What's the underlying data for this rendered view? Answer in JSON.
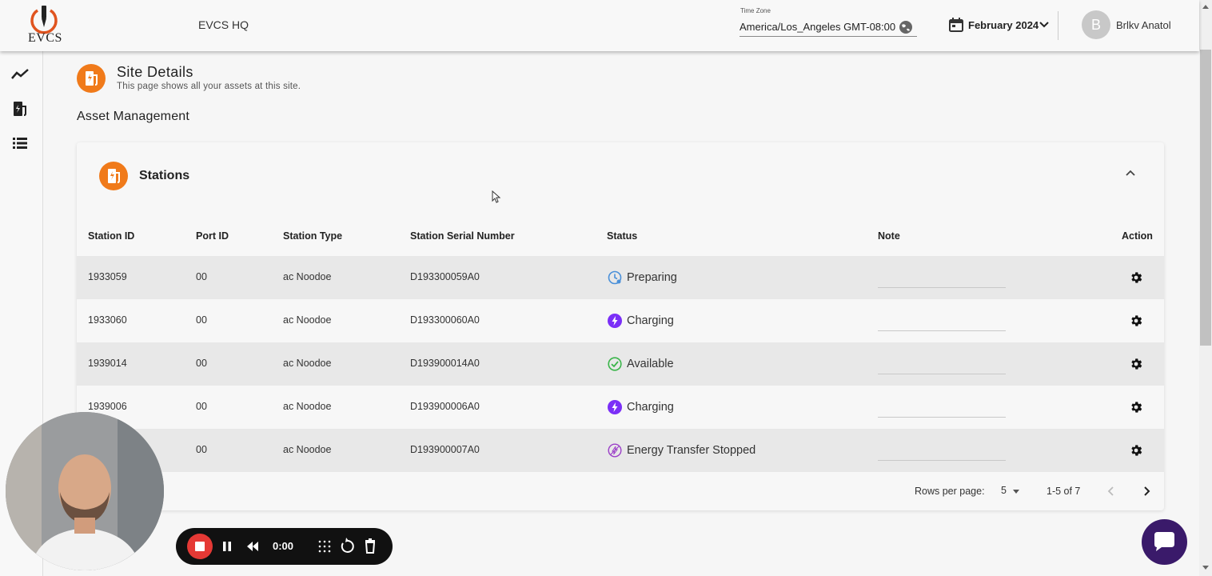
{
  "header": {
    "logo_text": "EVCS",
    "site_name": "EVCS HQ",
    "timezone_label": "Time Zone",
    "timezone_value": "America/Los_Angeles GMT-08:00",
    "month": "February 2024",
    "user_initial": "B",
    "user_name": "Brlkv Anatol"
  },
  "sidebar": {
    "items": [
      {
        "icon": "trend-chart-icon"
      },
      {
        "icon": "ev-station-icon"
      },
      {
        "icon": "list-icon"
      }
    ]
  },
  "page": {
    "title": "Site Details",
    "subtitle": "This page shows all your assets at this site.",
    "section_title": "Asset Management"
  },
  "stations": {
    "title": "Stations",
    "columns": [
      "Station ID",
      "Port ID",
      "Station Type",
      "Station Serial Number",
      "Status",
      "Note",
      "Action"
    ],
    "rows": [
      {
        "station_id": "1933059",
        "port_id": "00",
        "type": "ac Noodoe",
        "serial": "D193300059A0",
        "status": "Preparing",
        "status_icon": "clock-icon",
        "status_color": "#4a90d9"
      },
      {
        "station_id": "1933060",
        "port_id": "00",
        "type": "ac Noodoe",
        "serial": "D193300060A0",
        "status": "Charging",
        "status_icon": "lightning-icon",
        "status_color": "#7b2ff7"
      },
      {
        "station_id": "1939014",
        "port_id": "00",
        "type": "ac Noodoe",
        "serial": "D193900014A0",
        "status": "Available",
        "status_icon": "check-circle-icon",
        "status_color": "#3ab54a"
      },
      {
        "station_id": "1939006",
        "port_id": "00",
        "type": "ac Noodoe",
        "serial": "D193900006A0",
        "status": "Charging",
        "status_icon": "lightning-icon",
        "status_color": "#7b2ff7"
      },
      {
        "station_id": "",
        "port_id": "00",
        "type": "ac Noodoe",
        "serial": "D193900007A0",
        "status": "Energy Transfer Stopped",
        "status_icon": "stopped-icon",
        "status_color": "#9b3fc8"
      }
    ],
    "pagination": {
      "rows_per_page_label": "Rows per page:",
      "rows_per_page": "5",
      "range": "1-5 of 7"
    }
  },
  "recorder": {
    "time": "0:00"
  },
  "colors": {
    "accent": "#f07a1a",
    "chat": "#3a1a6a"
  }
}
